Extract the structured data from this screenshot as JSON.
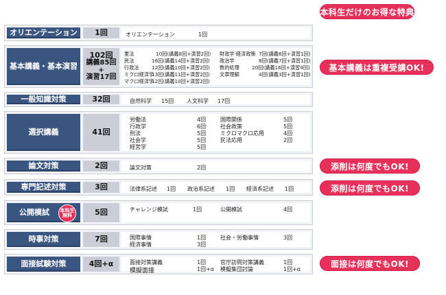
{
  "pills": {
    "top": "本科生だけのお得な特典",
    "kihon": "基本講義は重複受講OK!",
    "ronbun": "添削は何度でもOK!",
    "senmon": "添削は何度でもOK!",
    "mensetsu": "面接は何度でもOK!"
  },
  "rows": {
    "orientation": {
      "label": "オリエンテーション",
      "count": "1回",
      "cells": [
        "オリエンテーション",
        "1回"
      ]
    },
    "kihon": {
      "label": "基本講義・基本演習",
      "count": [
        "102回",
        "講義85回",
        "+",
        "演習17回"
      ],
      "left": [
        [
          "憲法",
          "10回(講義8回+演習2回)"
        ],
        [
          "民法",
          "16回(講義14回+演習2回)"
        ],
        [
          "行政法",
          "12回(講義10回+演習2回)"
        ],
        [
          "ミクロ経済学",
          "13回(講義11回+演習2回)"
        ],
        [
          "マクロ経済学",
          "12回(講義10回+演習2回)"
        ]
      ],
      "right": [
        [
          "財政学·経済政策",
          "7回(講義6回+演習1回)"
        ],
        [
          "政治学",
          "8回(講義7回+演習1回)"
        ],
        [
          "数的処理",
          "20回(講義16回+演習4回)"
        ],
        [
          "文章理解",
          "4回(講義3回+演習1回)"
        ]
      ]
    },
    "ippan": {
      "label": "一般知識対策",
      "count": "32回",
      "cells": [
        "自然科学",
        "15回",
        "人文科学",
        "17回"
      ]
    },
    "sentaku": {
      "label": "選択講義",
      "count": "41回",
      "left": [
        [
          "労働法",
          "4回"
        ],
        [
          "行政学",
          "6回"
        ],
        [
          "刑法",
          "5回"
        ],
        [
          "社会学",
          "5回"
        ],
        [
          "経営学",
          "5回"
        ]
      ],
      "right": [
        [
          "国際関係",
          "5回"
        ],
        [
          "社会政策",
          "5回"
        ],
        [
          "ミクロマクロ応用",
          "4回"
        ],
        [
          "民法応用",
          "2回"
        ]
      ]
    },
    "ronbun": {
      "label": "論文対策",
      "count": "2回",
      "cells": [
        "論文対策",
        "2回"
      ]
    },
    "senmon": {
      "label": "専門記述対策",
      "count": "3回",
      "cells": [
        "法律系記述",
        "1回",
        "政治系記述",
        "1回",
        "経済系記述",
        "1回"
      ]
    },
    "koukai": {
      "label": "公開模試",
      "count": "5回",
      "badge": [
        "本科生",
        "無料"
      ],
      "cells": [
        "チャレンジ模試",
        "1回",
        "公開模試",
        "4回"
      ]
    },
    "jiji": {
      "label": "時事対策",
      "count": "7回",
      "cells": [
        "国際事情",
        "1回",
        "社会・労働事情",
        "3回",
        "経済事情",
        "3回"
      ]
    },
    "mensetsu": {
      "label": "面接試験対策",
      "count": "4回+α",
      "cells": [
        "面接対策講義",
        "1回",
        "官庁訪問対策講義",
        "1回",
        "模擬面接",
        "1回+α",
        "模擬集団討論",
        "1回+α"
      ]
    }
  }
}
